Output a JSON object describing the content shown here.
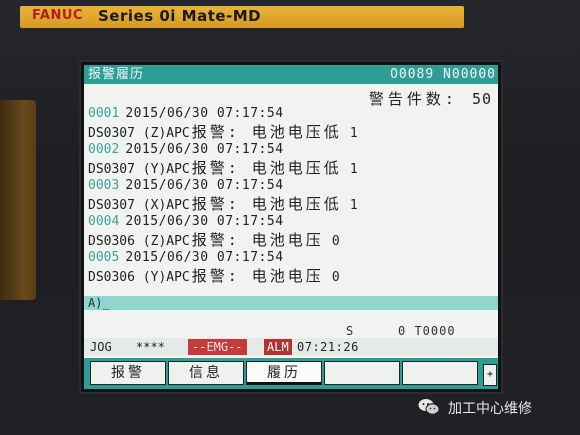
{
  "bezel": {
    "brand": "FANUC",
    "series": "Series 0i Mate-MD"
  },
  "screen": {
    "title": "报警履历",
    "program": "O0089 N00000",
    "count_label": "警告件数:",
    "count_value": "50"
  },
  "alarms": [
    {
      "num": "0001",
      "datetime": "2015/06/30 07:17:54",
      "code": "DS0307 (Z)APC",
      "message": "报警: 电池电压低",
      "value": "1"
    },
    {
      "num": "0002",
      "datetime": "2015/06/30 07:17:54",
      "code": "DS0307 (Y)APC",
      "message": "报警: 电池电压低",
      "value": "1"
    },
    {
      "num": "0003",
      "datetime": "2015/06/30 07:17:54",
      "code": "DS0307 (X)APC",
      "message": "报警: 电池电压低",
      "value": "1"
    },
    {
      "num": "0004",
      "datetime": "2015/06/30 07:17:54",
      "code": "DS0306 (Z)APC",
      "message": "报警: 电池电压",
      "value": "0"
    },
    {
      "num": "0005",
      "datetime": "2015/06/30 07:17:54",
      "code": "DS0306 (Y)APC",
      "message": "报警: 电池电压",
      "value": "0"
    }
  ],
  "input_line": "A)_",
  "status": {
    "s_label": "S",
    "spindle_tool": "0 T0000",
    "mode": "JOG",
    "stars": "****",
    "emg": "--EMG--",
    "alm": "ALM",
    "time": "07:21:26"
  },
  "softkeys": [
    "报警",
    "信息",
    "履历",
    "",
    ""
  ],
  "softkey_active": 2,
  "softkey_more": "+",
  "watermark": "加工中心维修",
  "colors": {
    "teal": "#2d9e95",
    "alarm_red": "#c53a3a",
    "brand_gold": "#e8b43a"
  }
}
